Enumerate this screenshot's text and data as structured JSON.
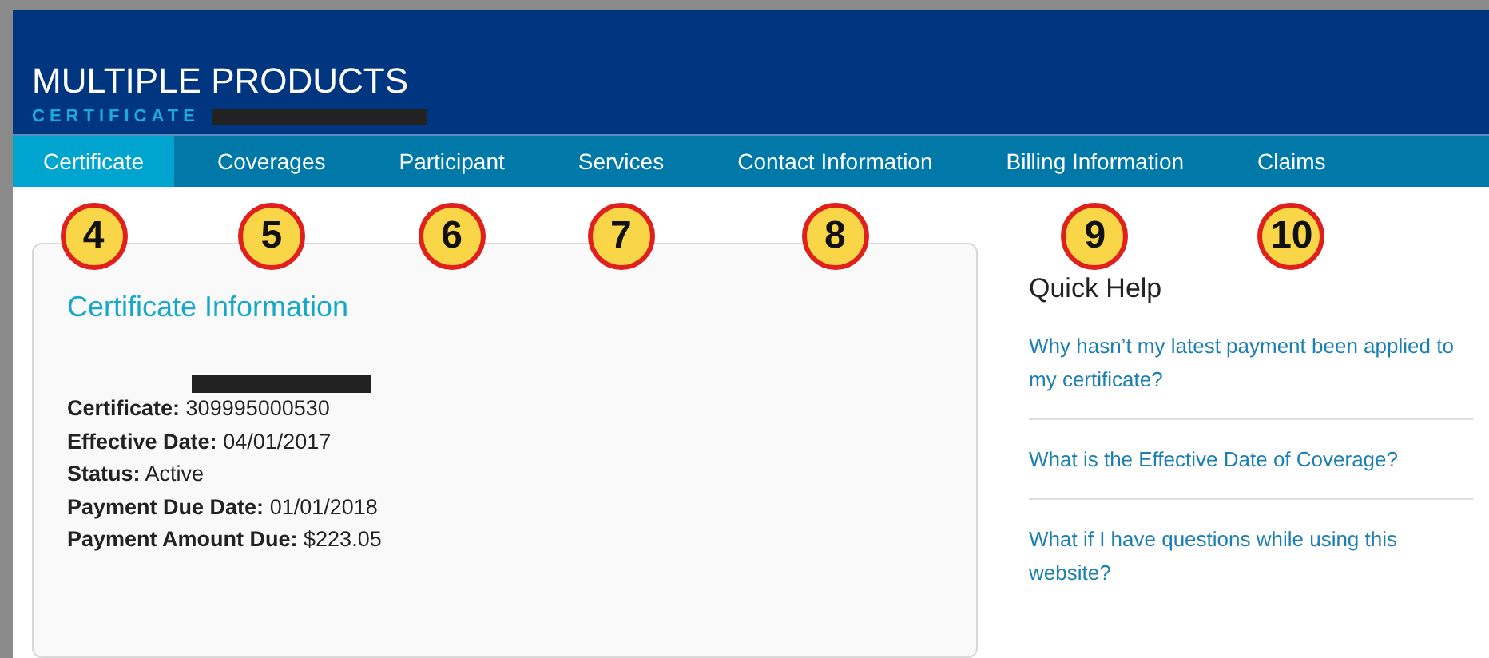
{
  "header": {
    "title": "MULTIPLE PRODUCTS",
    "subtitle": "CERTIFICATE"
  },
  "tabs": [
    {
      "label": "Certificate",
      "selected": true,
      "callout": "4"
    },
    {
      "label": "Coverages",
      "selected": false,
      "callout": "5"
    },
    {
      "label": "Participant",
      "selected": false,
      "callout": "6"
    },
    {
      "label": "Services",
      "selected": false,
      "callout": "7"
    },
    {
      "label": "Contact Information",
      "selected": false,
      "callout": "8"
    },
    {
      "label": "Billing Information",
      "selected": false,
      "callout": "9"
    },
    {
      "label": "Claims",
      "selected": false,
      "callout": "10"
    }
  ],
  "certificate_info": {
    "title": "Certificate Information",
    "fields": [
      {
        "label": "Certificate:",
        "value": "309995000530"
      },
      {
        "label": "Effective Date:",
        "value": "04/01/2017"
      },
      {
        "label": "Status:",
        "value": "Active"
      },
      {
        "label": "Payment Due Date:",
        "value": "01/01/2018"
      },
      {
        "label": "Payment Amount Due:",
        "value": "$223.05"
      }
    ]
  },
  "quick_help": {
    "title": "Quick Help",
    "links": [
      "Why hasn’t my latest payment been applied to my certificate?",
      "What is the Effective Date of Coverage?",
      "What if I have questions while using this website?"
    ]
  }
}
